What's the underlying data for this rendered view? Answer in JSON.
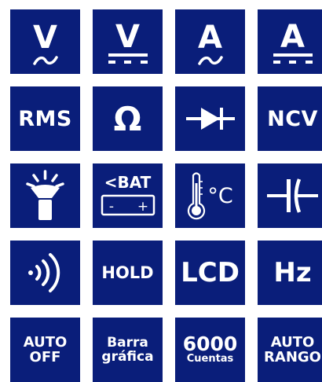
{
  "colors": {
    "tile_background": "#0a1e7a",
    "foreground": "#ffffff"
  },
  "tiles": {
    "ac_voltage": {
      "symbol": "V",
      "icon": "ac-voltage-icon"
    },
    "dc_voltage": {
      "symbol": "V",
      "icon": "dc-voltage-icon"
    },
    "ac_current": {
      "symbol": "A",
      "icon": "ac-current-icon"
    },
    "dc_current": {
      "symbol": "A",
      "icon": "dc-current-icon"
    },
    "rms": {
      "label": "RMS"
    },
    "resistance": {
      "symbol": "Ω",
      "icon": "ohm-icon"
    },
    "diode": {
      "icon": "diode-icon"
    },
    "ncv": {
      "label": "NCV"
    },
    "flashlight": {
      "icon": "flashlight-icon"
    },
    "low_battery": {
      "label": "<BAT",
      "minus": "-",
      "plus": "+",
      "icon": "battery-icon"
    },
    "temperature": {
      "unit": "°C",
      "icon": "thermometer-icon"
    },
    "capacitance": {
      "icon": "capacitor-icon"
    },
    "wireless": {
      "icon": "wireless-signal-icon"
    },
    "hold": {
      "label": "HOLD"
    },
    "lcd": {
      "label": "LCD"
    },
    "frequency": {
      "label": "Hz"
    },
    "auto_off": {
      "line1": "AUTO",
      "line2": "OFF"
    },
    "bar_graph": {
      "line1": "Barra",
      "line2": "gráfica"
    },
    "counts": {
      "line1": "6000",
      "line2": "Cuentas"
    },
    "auto_range": {
      "line1": "AUTO",
      "line2": "RANGO"
    }
  }
}
